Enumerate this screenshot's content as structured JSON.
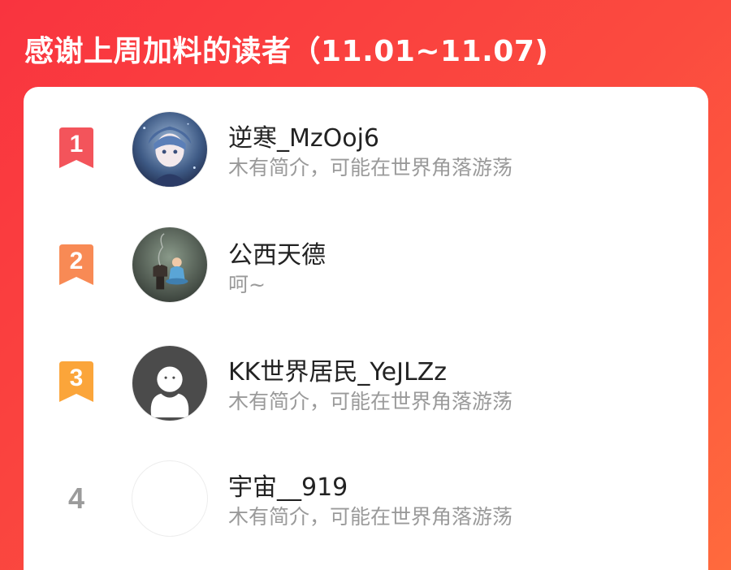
{
  "header": {
    "title": "感谢上周加料的读者（11.01~11.07)"
  },
  "colors": {
    "background_start": "#f9343f",
    "background_end": "#ff6a3d",
    "rank1": "#f3545b",
    "rank2": "#f88a55",
    "rank3": "#fba53a",
    "rank_plain": "#9b9b9b"
  },
  "readers": [
    {
      "rank": "1",
      "name": "逆寒_MzOoj6",
      "bio": "木有简介，可能在世界角落游荡",
      "avatar": "anime-boy-avatar"
    },
    {
      "rank": "2",
      "name": "公西天德",
      "bio": "呵~",
      "avatar": "meditating-child-avatar"
    },
    {
      "rank": "3",
      "name": "KK世界居民_YeJLZz",
      "bio": "木有简介，可能在世界角落游荡",
      "avatar": "default-person-avatar"
    },
    {
      "rank": "4",
      "name": "宇宙__919",
      "bio": "木有简介，可能在世界角落游荡",
      "avatar": "blank-avatar"
    }
  ]
}
